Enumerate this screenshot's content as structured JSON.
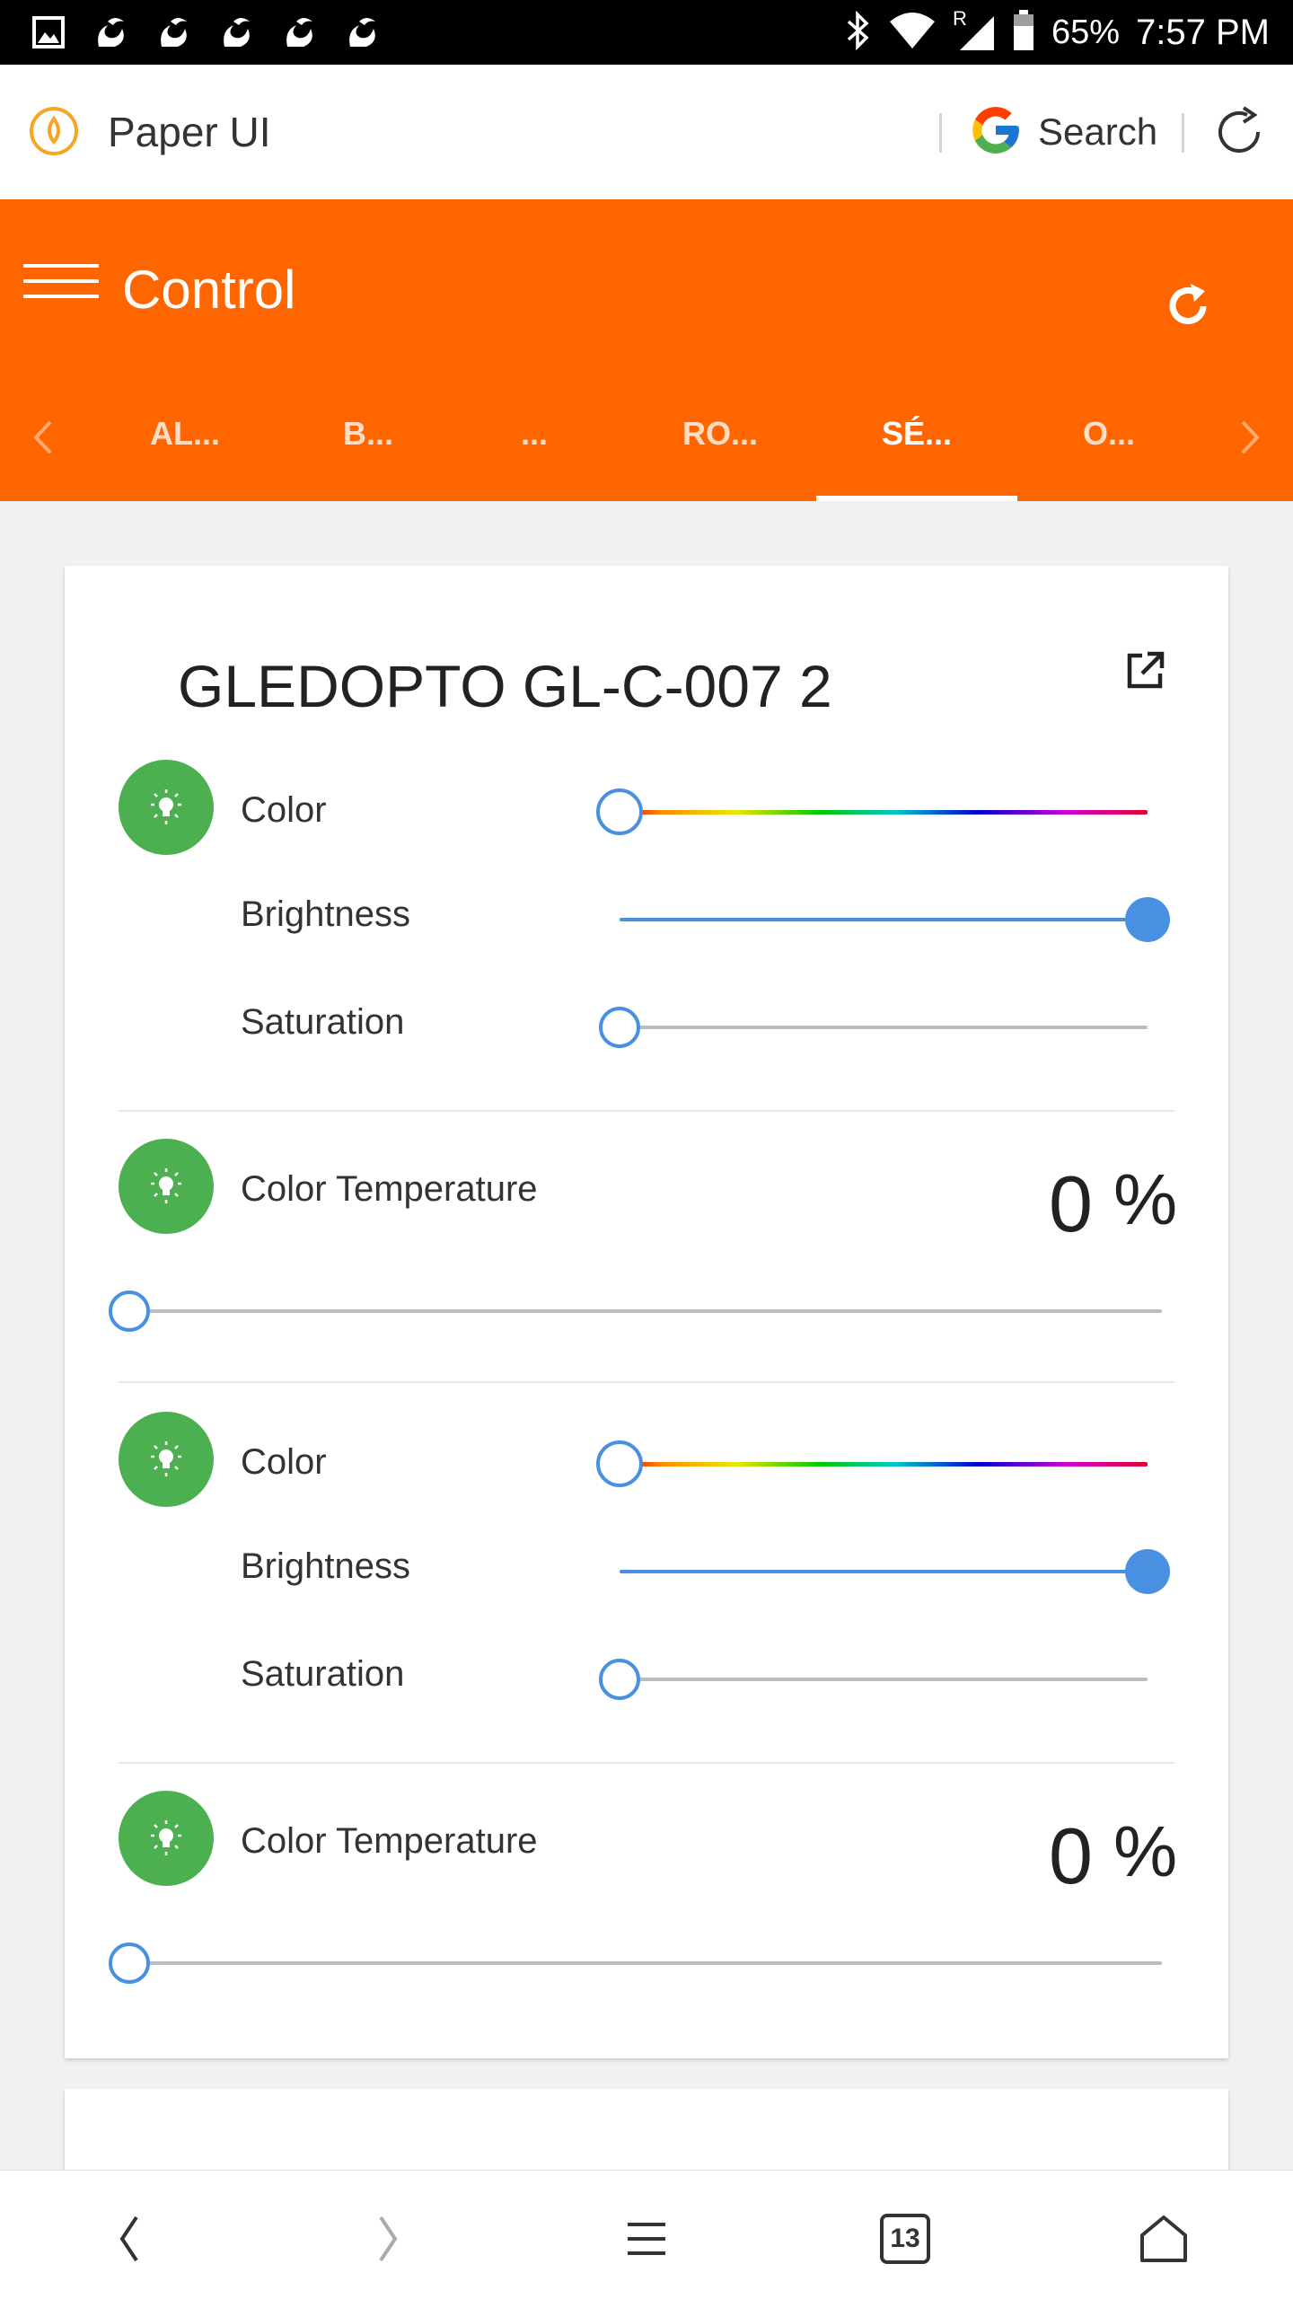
{
  "status_bar": {
    "battery": "65%",
    "time": "7:57 PM",
    "signal_roaming": "R"
  },
  "browser": {
    "site_title": "Paper UI",
    "search_label": "Search",
    "tab_count": "13"
  },
  "header": {
    "title": "Control",
    "tabs": [
      {
        "label": "AL..."
      },
      {
        "label": "B..."
      },
      {
        "label": "..."
      },
      {
        "label": "RO..."
      },
      {
        "label": "SÉ...",
        "active": true
      },
      {
        "label": "O..."
      }
    ]
  },
  "card": {
    "title": "GLEDOPTO GL-C-007 2",
    "groups": [
      {
        "color_label": "Color",
        "brightness_label": "Brightness",
        "saturation_label": "Saturation",
        "brightness_level": 1.0,
        "saturation_level": 0.0,
        "hue_level": 0.0
      },
      {
        "label": "Color Temperature",
        "value": "0",
        "unit": "%",
        "level": 0.0
      },
      {
        "color_label": "Color",
        "brightness_label": "Brightness",
        "saturation_label": "Saturation",
        "brightness_level": 1.0,
        "saturation_level": 0.0,
        "hue_level": 0.0
      },
      {
        "label": "Color Temperature",
        "value": "0",
        "unit": "%",
        "level": 0.0
      }
    ]
  },
  "colors": {
    "accent": "#ff6600",
    "bulb": "#4caf50",
    "slider": "#4a90e2"
  }
}
